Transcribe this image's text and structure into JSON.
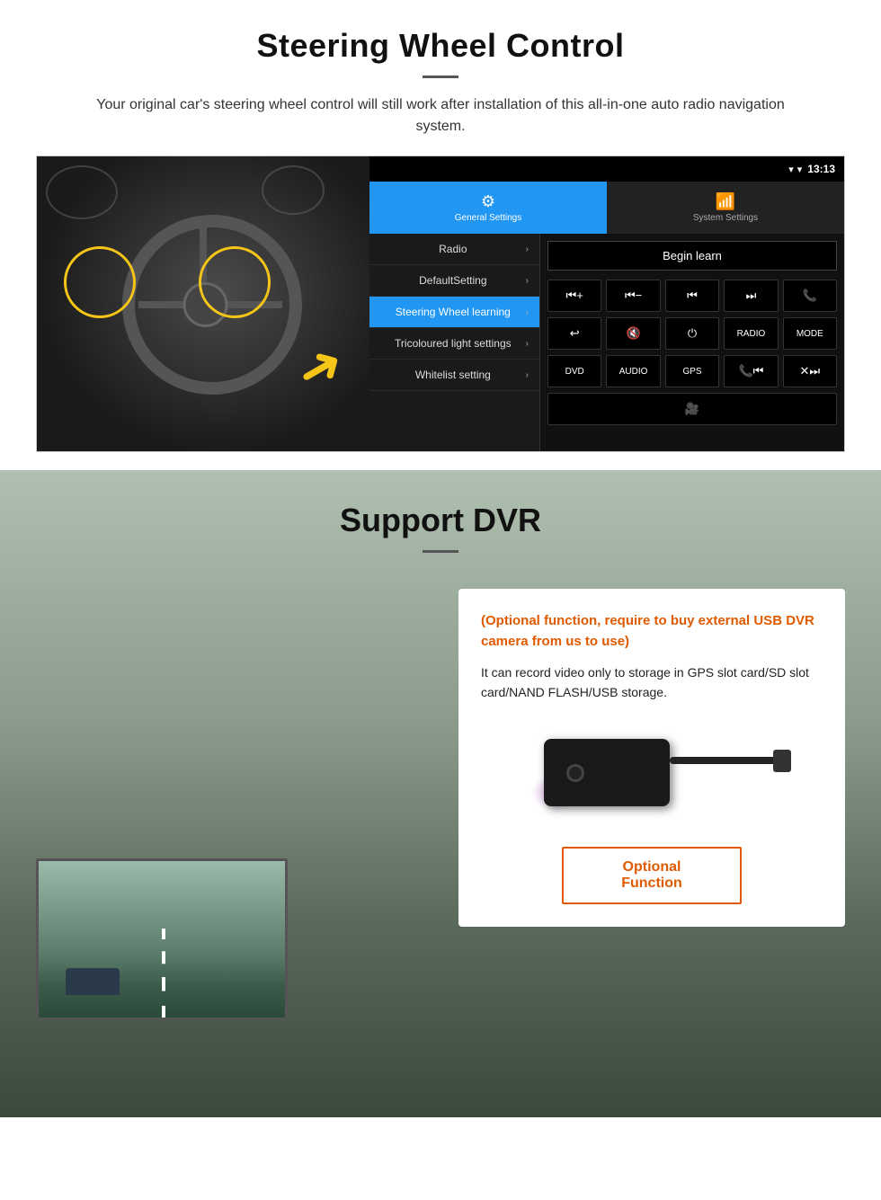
{
  "page": {
    "steering": {
      "title": "Steering Wheel Control",
      "subtitle": "Your original car's steering wheel control will still work after installation of this all-in-one auto radio navigation system.",
      "statusbar": {
        "time": "13:13",
        "signal": "▾",
        "wifi": "▾",
        "battery": "■"
      },
      "tabs": [
        {
          "label": "General Settings",
          "icon": "⚙",
          "active": true
        },
        {
          "label": "System Settings",
          "icon": "📶",
          "active": false
        }
      ],
      "menu_items": [
        {
          "label": "Radio",
          "active": false
        },
        {
          "label": "DefaultSetting",
          "active": false
        },
        {
          "label": "Steering Wheel learning",
          "active": true
        },
        {
          "label": "Tricoloured light settings",
          "active": false
        },
        {
          "label": "Whitelist setting",
          "active": false
        }
      ],
      "begin_learn_label": "Begin learn",
      "control_buttons": [
        [
          "⏮+",
          "⏮−",
          "⏮",
          "⏭",
          "📞"
        ],
        [
          "↩",
          "🔇×",
          "⏻",
          "RADIO",
          "MODE"
        ],
        [
          "DVD",
          "AUDIO",
          "GPS",
          "📞⏮",
          "✕⏭"
        ],
        [
          "📹"
        ]
      ]
    },
    "dvr": {
      "title": "Support DVR",
      "optional_text": "(Optional function, require to buy external USB DVR camera from us to use)",
      "desc_text": "It can record video only to storage in GPS slot card/SD slot card/NAND FLASH/USB storage.",
      "optional_button_label": "Optional Function"
    }
  }
}
